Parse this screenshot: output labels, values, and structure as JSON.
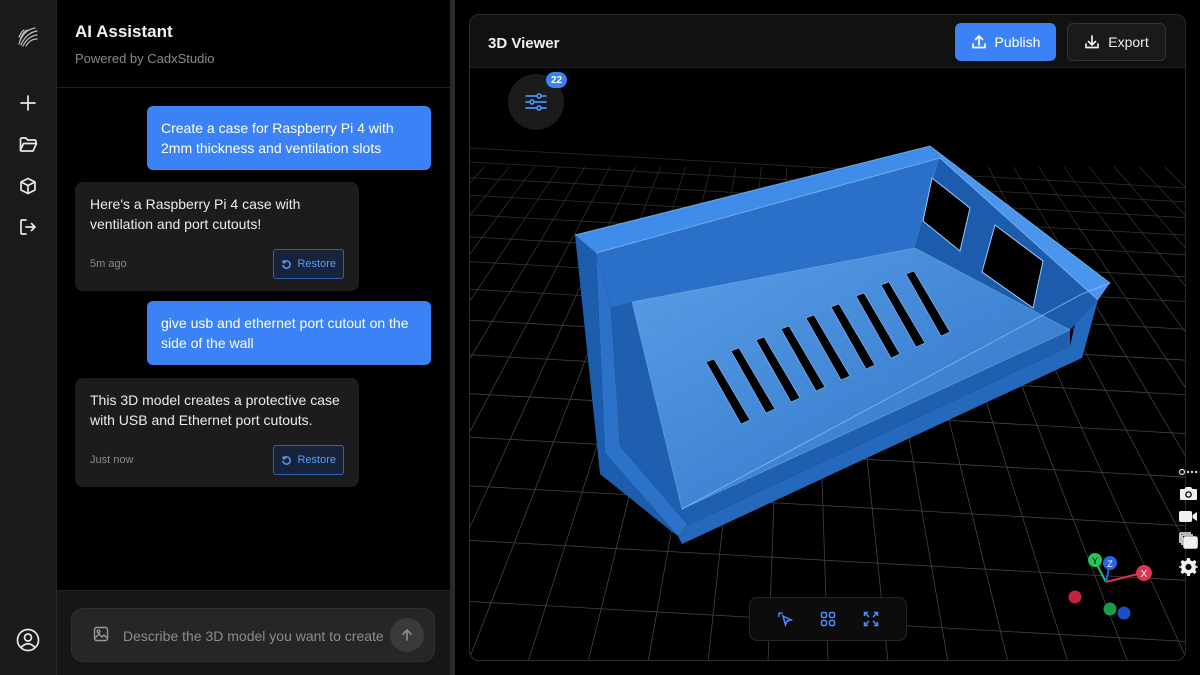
{
  "rail": {
    "items": [
      {
        "icon": "new-chat-icon"
      },
      {
        "icon": "folder-icon"
      },
      {
        "icon": "cube-icon"
      },
      {
        "icon": "logout-icon"
      },
      {
        "icon": "user-profile-icon"
      }
    ]
  },
  "chat": {
    "title": "AI Assistant",
    "subtitle": "Powered by CadxStudio",
    "messages": [
      {
        "role": "user",
        "text": "Create a case for Raspberry Pi 4 with 2mm thickness and ventilation slots"
      },
      {
        "role": "assistant",
        "text": "Here's a Raspberry Pi 4 case with ventilation and port cutouts!",
        "time": "5m ago",
        "restore_label": "Restore"
      },
      {
        "role": "user",
        "text": "give usb and ethernet port cutout on the side of the wall"
      },
      {
        "role": "assistant",
        "text": "This 3D model creates a protective case with USB and Ethernet port cutouts.",
        "time": "Just now",
        "restore_label": "Restore"
      }
    ],
    "input": {
      "placeholder": "Describe the 3D model you want to create...",
      "value": ""
    }
  },
  "viewer": {
    "title": "3D Viewer",
    "publish_label": "Publish",
    "export_label": "Export",
    "settings_badge": "22",
    "accent": "#3b82f6",
    "model_color": "#2f7bd6",
    "gizmo": {
      "x_label": "X",
      "y_label": "Y",
      "z_label": "Z",
      "x_color": "#e0334f",
      "y_color": "#22c55e",
      "z_color": "#2563eb"
    },
    "bottom_tools": [
      "select-pointer-icon",
      "grid-view-icon",
      "fullscreen-icon"
    ],
    "side_tools": [
      "camera-icon",
      "video-icon",
      "layers-icon",
      "gear-icon"
    ]
  }
}
